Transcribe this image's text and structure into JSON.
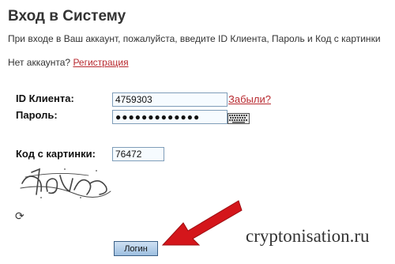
{
  "page": {
    "title": "Вход в Систему",
    "intro": "При входе в Ваш аккаунт, пожалуйста, введите ID Клиента, Пароль и Код с картинки",
    "no_account_text": "Нет аккаунта?",
    "register_link": "Регистрация"
  },
  "form": {
    "client_id_label": "ID Клиента:",
    "client_id_value": "4759303",
    "forgot_link": "Забыли?",
    "password_label": "Пароль:",
    "password_value": "●●●●●●●●●●●●●",
    "captcha_label": "Код с картинки:",
    "captcha_value": "76472",
    "refresh_icon": "⟳",
    "login_button": "Логин"
  },
  "watermark": "cryptonisation.ru",
  "colors": {
    "link": "#b8292f",
    "arrow": "#d4161b",
    "input_border": "#7f9db9"
  },
  "icons": [
    "keyboard-icon",
    "refresh-icon",
    "arrow-pointer"
  ]
}
